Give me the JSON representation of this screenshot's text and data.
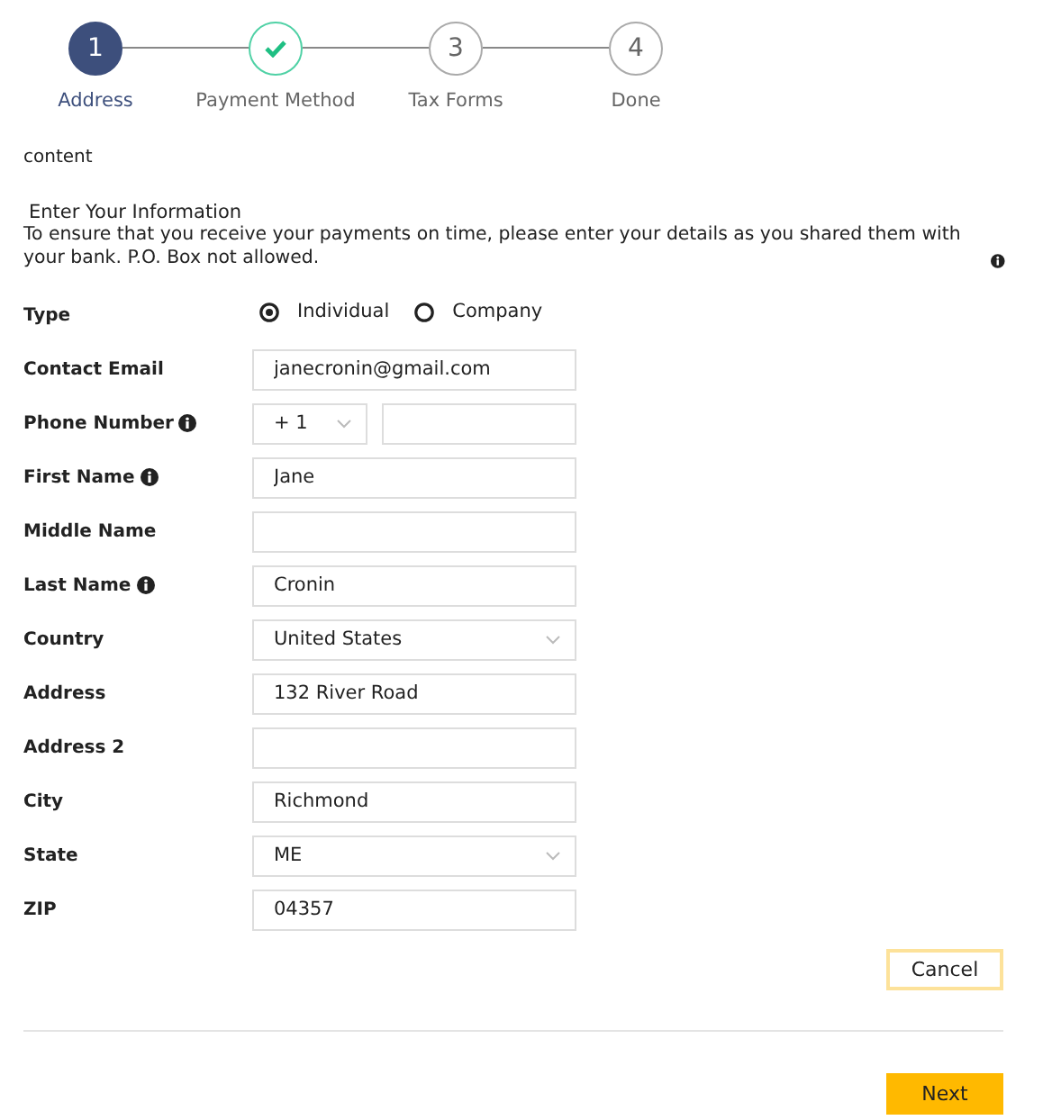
{
  "steps": [
    {
      "number": "1",
      "label": "Address",
      "current": true,
      "done": false
    },
    {
      "label": "Payment Method",
      "current": false,
      "done": true
    },
    {
      "number": "3",
      "label": "Tax Forms",
      "current": false,
      "done": false
    },
    {
      "number": "4",
      "label": "Done",
      "current": false,
      "done": false
    }
  ],
  "content_label": "content",
  "heading": "Enter Your Information",
  "description": "To ensure that you receive your payments on time, please enter your details as you shared them with your bank. P.O. Box not allowed.",
  "type_field": {
    "label": "Type",
    "options": [
      {
        "label": "Individual",
        "selected": true
      },
      {
        "label": "Company",
        "selected": false
      }
    ]
  },
  "fields": [
    {
      "kind": "text",
      "label": "Contact Email",
      "info": false,
      "value": "janecronin@gmail.com"
    },
    {
      "kind": "phone",
      "label": "Phone Number",
      "info": true,
      "code": "+ 1"
    },
    {
      "kind": "text",
      "label": "First Name",
      "info": true,
      "value": "Jane"
    },
    {
      "kind": "text",
      "label": "Middle Name",
      "info": false
    },
    {
      "kind": "text",
      "label": "Last Name",
      "info": true,
      "value": "Cronin"
    },
    {
      "kind": "select",
      "label": "Country",
      "info": false,
      "value": "United States"
    },
    {
      "kind": "text",
      "label": "Address",
      "info": false,
      "value": "132 River Road"
    },
    {
      "kind": "text",
      "label": "Address 2",
      "info": false
    },
    {
      "kind": "text",
      "label": "City",
      "info": false,
      "value": "Richmond"
    },
    {
      "kind": "select",
      "label": "State",
      "info": false,
      "value": "ME"
    },
    {
      "kind": "text",
      "label": "ZIP",
      "info": false,
      "value": "04357"
    }
  ],
  "buttons": {
    "cancel": "Cancel",
    "next": "Next"
  }
}
